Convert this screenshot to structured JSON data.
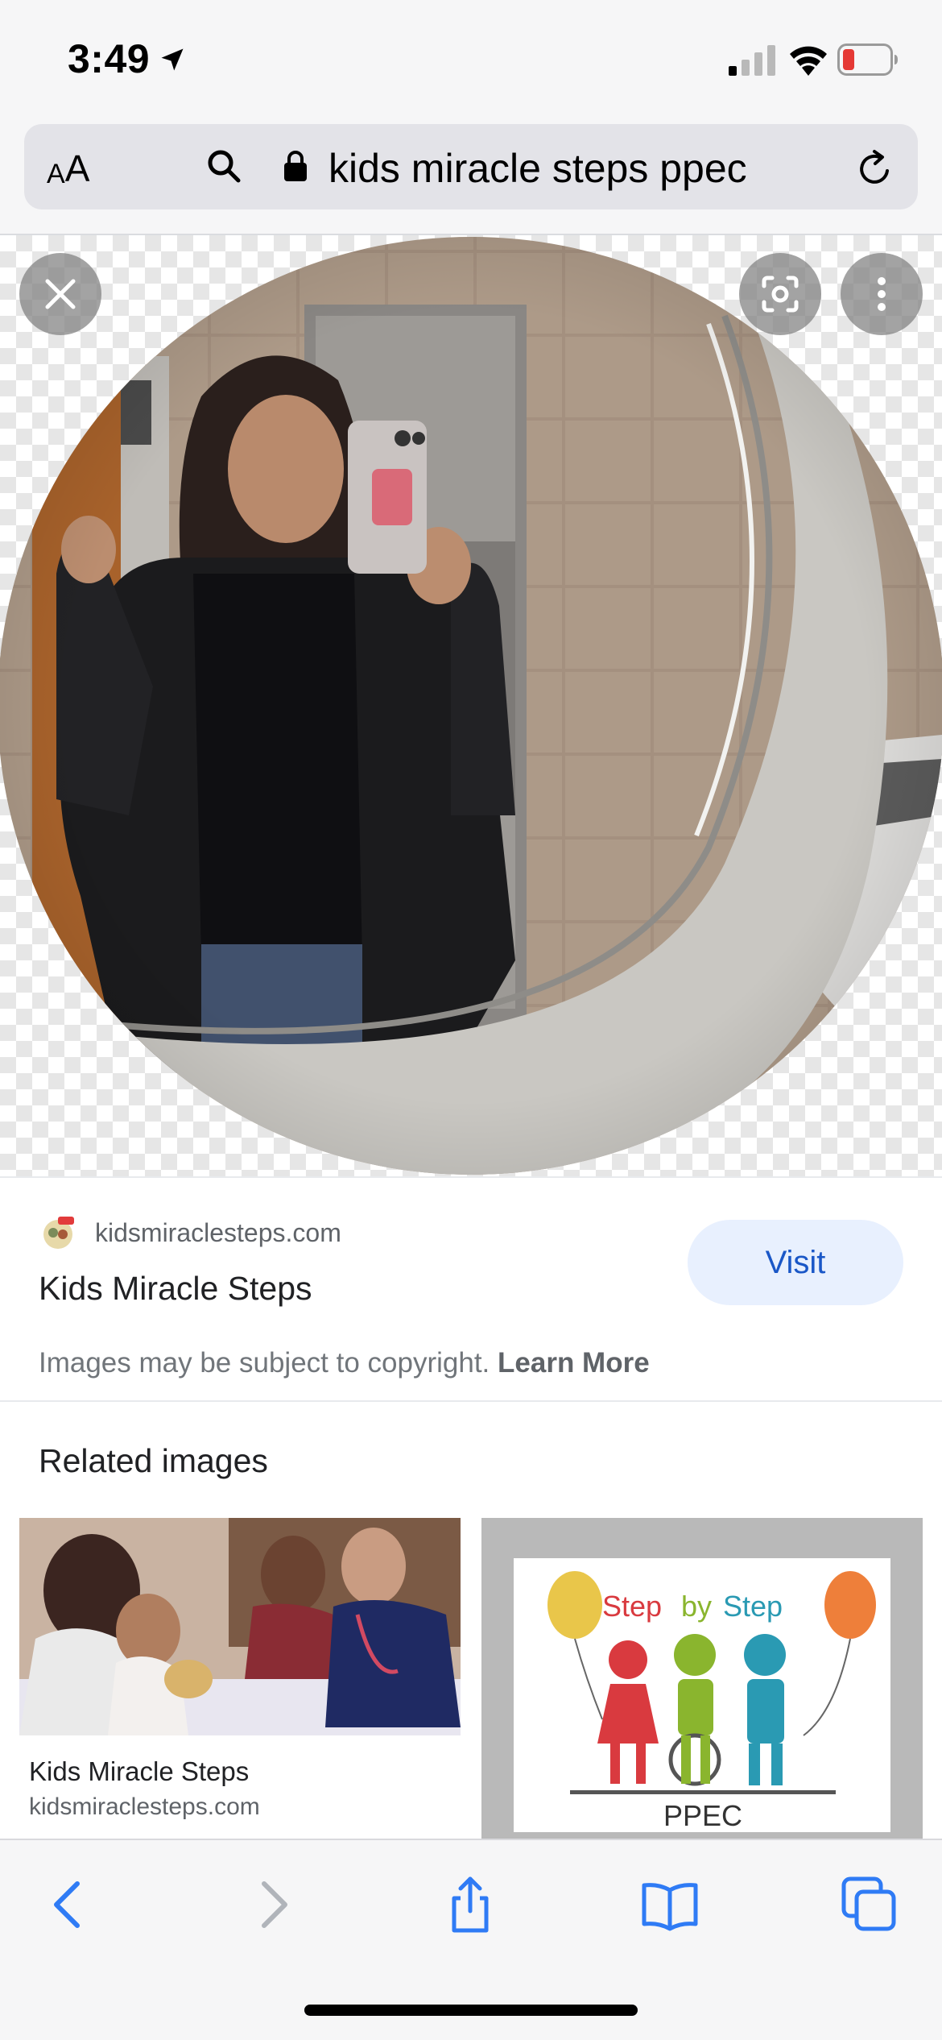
{
  "status_bar": {
    "time": "3:49"
  },
  "address_bar": {
    "aa_small": "A",
    "aa_big": "A",
    "url_text": "kids miracle steps ppec"
  },
  "source": {
    "domain": "kidsmiraclesteps.com",
    "title": "Kids Miracle Steps",
    "visit_label": "Visit",
    "copyright_text": "Images may be subject to copyright.",
    "learn_more_label": "Learn More"
  },
  "related": {
    "heading": "Related images",
    "items": [
      {
        "title": "Kids Miracle Steps",
        "domain": "kidsmiraclesteps.com"
      },
      {
        "logo_text_step": "Step",
        "logo_text_by": "by",
        "logo_text_step2": "Step",
        "logo_caption": "PPEC"
      }
    ]
  },
  "colors": {
    "accent_blue": "#1a57c7",
    "visit_bg": "#e8f0fe",
    "battery_low": "#e53935",
    "toolbar_blue": "#2f7bf5",
    "toolbar_disabled": "#b0b4ba"
  },
  "icons": {
    "location": "location-arrow-icon",
    "signal": "cellular-signal-icon",
    "wifi": "wifi-icon",
    "battery": "battery-icon",
    "search": "search-icon",
    "lock": "lock-icon",
    "reload": "reload-icon",
    "close": "close-icon",
    "lens": "lens-search-icon",
    "more": "more-vert-icon",
    "back": "chevron-left-icon",
    "forward": "chevron-right-icon",
    "share": "share-icon",
    "bookmarks": "book-icon",
    "tabs": "tabs-icon"
  }
}
